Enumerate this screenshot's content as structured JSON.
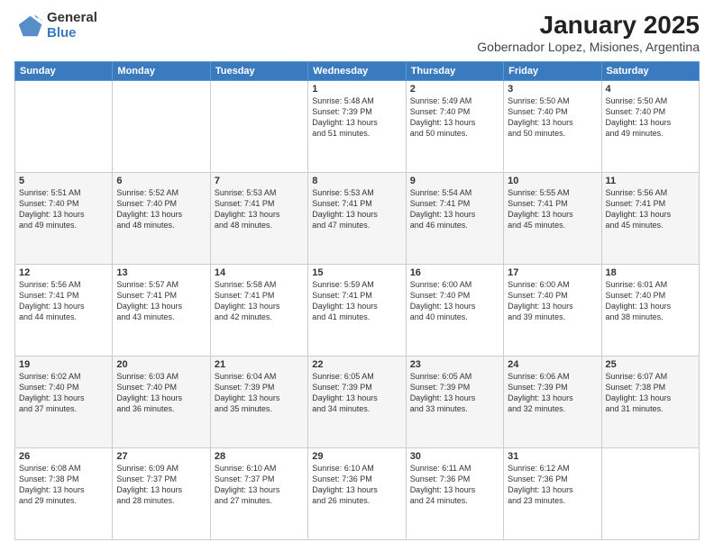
{
  "logo": {
    "general": "General",
    "blue": "Blue"
  },
  "title": "January 2025",
  "subtitle": "Gobernador Lopez, Misiones, Argentina",
  "days_of_week": [
    "Sunday",
    "Monday",
    "Tuesday",
    "Wednesday",
    "Thursday",
    "Friday",
    "Saturday"
  ],
  "weeks": [
    [
      {
        "num": "",
        "info": ""
      },
      {
        "num": "",
        "info": ""
      },
      {
        "num": "",
        "info": ""
      },
      {
        "num": "1",
        "info": "Sunrise: 5:48 AM\nSunset: 7:39 PM\nDaylight: 13 hours\nand 51 minutes."
      },
      {
        "num": "2",
        "info": "Sunrise: 5:49 AM\nSunset: 7:40 PM\nDaylight: 13 hours\nand 50 minutes."
      },
      {
        "num": "3",
        "info": "Sunrise: 5:50 AM\nSunset: 7:40 PM\nDaylight: 13 hours\nand 50 minutes."
      },
      {
        "num": "4",
        "info": "Sunrise: 5:50 AM\nSunset: 7:40 PM\nDaylight: 13 hours\nand 49 minutes."
      }
    ],
    [
      {
        "num": "5",
        "info": "Sunrise: 5:51 AM\nSunset: 7:40 PM\nDaylight: 13 hours\nand 49 minutes."
      },
      {
        "num": "6",
        "info": "Sunrise: 5:52 AM\nSunset: 7:40 PM\nDaylight: 13 hours\nand 48 minutes."
      },
      {
        "num": "7",
        "info": "Sunrise: 5:53 AM\nSunset: 7:41 PM\nDaylight: 13 hours\nand 48 minutes."
      },
      {
        "num": "8",
        "info": "Sunrise: 5:53 AM\nSunset: 7:41 PM\nDaylight: 13 hours\nand 47 minutes."
      },
      {
        "num": "9",
        "info": "Sunrise: 5:54 AM\nSunset: 7:41 PM\nDaylight: 13 hours\nand 46 minutes."
      },
      {
        "num": "10",
        "info": "Sunrise: 5:55 AM\nSunset: 7:41 PM\nDaylight: 13 hours\nand 45 minutes."
      },
      {
        "num": "11",
        "info": "Sunrise: 5:56 AM\nSunset: 7:41 PM\nDaylight: 13 hours\nand 45 minutes."
      }
    ],
    [
      {
        "num": "12",
        "info": "Sunrise: 5:56 AM\nSunset: 7:41 PM\nDaylight: 13 hours\nand 44 minutes."
      },
      {
        "num": "13",
        "info": "Sunrise: 5:57 AM\nSunset: 7:41 PM\nDaylight: 13 hours\nand 43 minutes."
      },
      {
        "num": "14",
        "info": "Sunrise: 5:58 AM\nSunset: 7:41 PM\nDaylight: 13 hours\nand 42 minutes."
      },
      {
        "num": "15",
        "info": "Sunrise: 5:59 AM\nSunset: 7:41 PM\nDaylight: 13 hours\nand 41 minutes."
      },
      {
        "num": "16",
        "info": "Sunrise: 6:00 AM\nSunset: 7:40 PM\nDaylight: 13 hours\nand 40 minutes."
      },
      {
        "num": "17",
        "info": "Sunrise: 6:00 AM\nSunset: 7:40 PM\nDaylight: 13 hours\nand 39 minutes."
      },
      {
        "num": "18",
        "info": "Sunrise: 6:01 AM\nSunset: 7:40 PM\nDaylight: 13 hours\nand 38 minutes."
      }
    ],
    [
      {
        "num": "19",
        "info": "Sunrise: 6:02 AM\nSunset: 7:40 PM\nDaylight: 13 hours\nand 37 minutes."
      },
      {
        "num": "20",
        "info": "Sunrise: 6:03 AM\nSunset: 7:40 PM\nDaylight: 13 hours\nand 36 minutes."
      },
      {
        "num": "21",
        "info": "Sunrise: 6:04 AM\nSunset: 7:39 PM\nDaylight: 13 hours\nand 35 minutes."
      },
      {
        "num": "22",
        "info": "Sunrise: 6:05 AM\nSunset: 7:39 PM\nDaylight: 13 hours\nand 34 minutes."
      },
      {
        "num": "23",
        "info": "Sunrise: 6:05 AM\nSunset: 7:39 PM\nDaylight: 13 hours\nand 33 minutes."
      },
      {
        "num": "24",
        "info": "Sunrise: 6:06 AM\nSunset: 7:39 PM\nDaylight: 13 hours\nand 32 minutes."
      },
      {
        "num": "25",
        "info": "Sunrise: 6:07 AM\nSunset: 7:38 PM\nDaylight: 13 hours\nand 31 minutes."
      }
    ],
    [
      {
        "num": "26",
        "info": "Sunrise: 6:08 AM\nSunset: 7:38 PM\nDaylight: 13 hours\nand 29 minutes."
      },
      {
        "num": "27",
        "info": "Sunrise: 6:09 AM\nSunset: 7:37 PM\nDaylight: 13 hours\nand 28 minutes."
      },
      {
        "num": "28",
        "info": "Sunrise: 6:10 AM\nSunset: 7:37 PM\nDaylight: 13 hours\nand 27 minutes."
      },
      {
        "num": "29",
        "info": "Sunrise: 6:10 AM\nSunset: 7:36 PM\nDaylight: 13 hours\nand 26 minutes."
      },
      {
        "num": "30",
        "info": "Sunrise: 6:11 AM\nSunset: 7:36 PM\nDaylight: 13 hours\nand 24 minutes."
      },
      {
        "num": "31",
        "info": "Sunrise: 6:12 AM\nSunset: 7:36 PM\nDaylight: 13 hours\nand 23 minutes."
      },
      {
        "num": "",
        "info": ""
      }
    ]
  ]
}
